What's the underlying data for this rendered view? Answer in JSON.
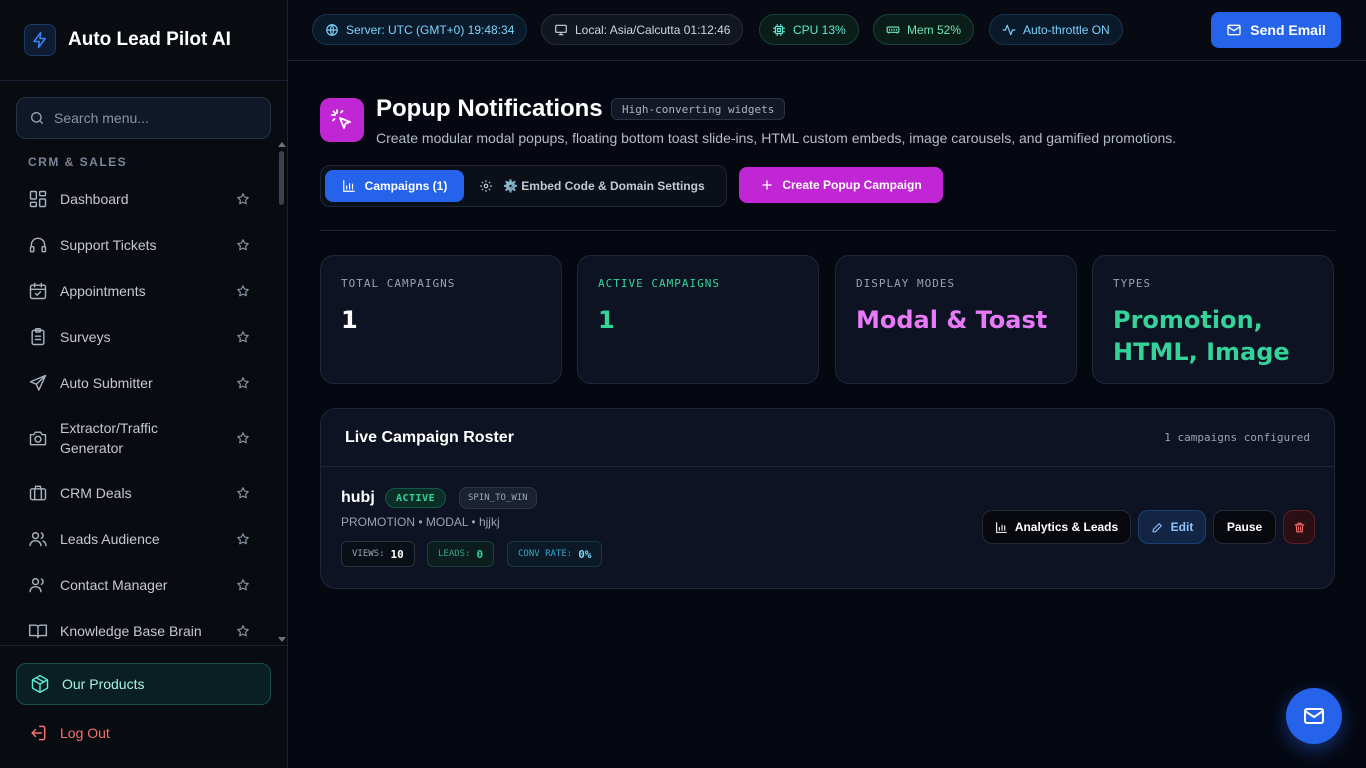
{
  "app": {
    "title": "Auto Lead Pilot AI"
  },
  "sidebar": {
    "search_placeholder": "Search menu...",
    "section_heading": "CRM & SALES",
    "items": [
      {
        "label": "Dashboard",
        "icon": "dashboard-icon"
      },
      {
        "label": "Support Tickets",
        "icon": "headset-icon"
      },
      {
        "label": "Appointments",
        "icon": "calendar-check-icon"
      },
      {
        "label": "Surveys",
        "icon": "clipboard-list-icon"
      },
      {
        "label": "Auto Submitter",
        "icon": "send-icon"
      },
      {
        "label": "Extractor/Traffic Generator",
        "icon": "camera-icon"
      },
      {
        "label": "CRM Deals",
        "icon": "briefcase-icon"
      },
      {
        "label": "Leads Audience",
        "icon": "users-icon"
      },
      {
        "label": "Contact Manager",
        "icon": "contacts-icon"
      },
      {
        "label": "Knowledge Base Brain",
        "icon": "book-open-icon"
      }
    ],
    "products_label": "Our Products",
    "logout_label": "Log Out"
  },
  "topbar": {
    "server": "Server: UTC (GMT+0) 19:48:34",
    "local": "Local: Asia/Calcutta 01:12:46",
    "cpu": "CPU 13%",
    "mem": "Mem 52%",
    "throttle": "Auto-throttle ON",
    "send_email": "Send Email"
  },
  "page": {
    "title": "Popup Notifications",
    "tag": "High-converting widgets",
    "subtitle": "Create modular modal popups, floating bottom toast slide-ins, HTML custom embeds, image carousels, and gamified promotions.",
    "tab_campaigns": "Campaigns (1)",
    "tab_settings": "⚙️ Embed Code & Domain Settings",
    "create_button": "Create Popup Campaign"
  },
  "stats": [
    {
      "label": "TOTAL CAMPAIGNS",
      "value": "1",
      "label_color": "#9aa2b1",
      "value_color": "#ffffff"
    },
    {
      "label": "ACTIVE CAMPAIGNS",
      "value": "1",
      "label_color": "#34d399",
      "value_color": "#34d399"
    },
    {
      "label": "DISPLAY MODES",
      "value": "Modal & Toast",
      "label_color": "#9aa2b1",
      "value_color": "#e879f9"
    },
    {
      "label": "TYPES",
      "value": "Promotion, HTML, Image",
      "label_color": "#9aa2b1",
      "value_color": "#34d399"
    }
  ],
  "roster": {
    "title": "Live Campaign Roster",
    "count": "1 campaigns configured",
    "campaign": {
      "name": "hubj",
      "status": "ACTIVE",
      "type": "SPIN_TO_WIN",
      "meta": "PROMOTION • MODAL • hjjkj",
      "views_label": "VIEWS:",
      "views": "10",
      "leads_label": "LEADS:",
      "leads": "0",
      "conv_label": "CONV RATE:",
      "conv": "0%"
    },
    "actions": {
      "analytics": "Analytics & Leads",
      "edit": "Edit",
      "pause": "Pause"
    }
  },
  "colors": {
    "accent_blue": "#2563eb",
    "accent_magenta": "#c026d3",
    "accent_green": "#34d399",
    "danger": "#f87171"
  }
}
